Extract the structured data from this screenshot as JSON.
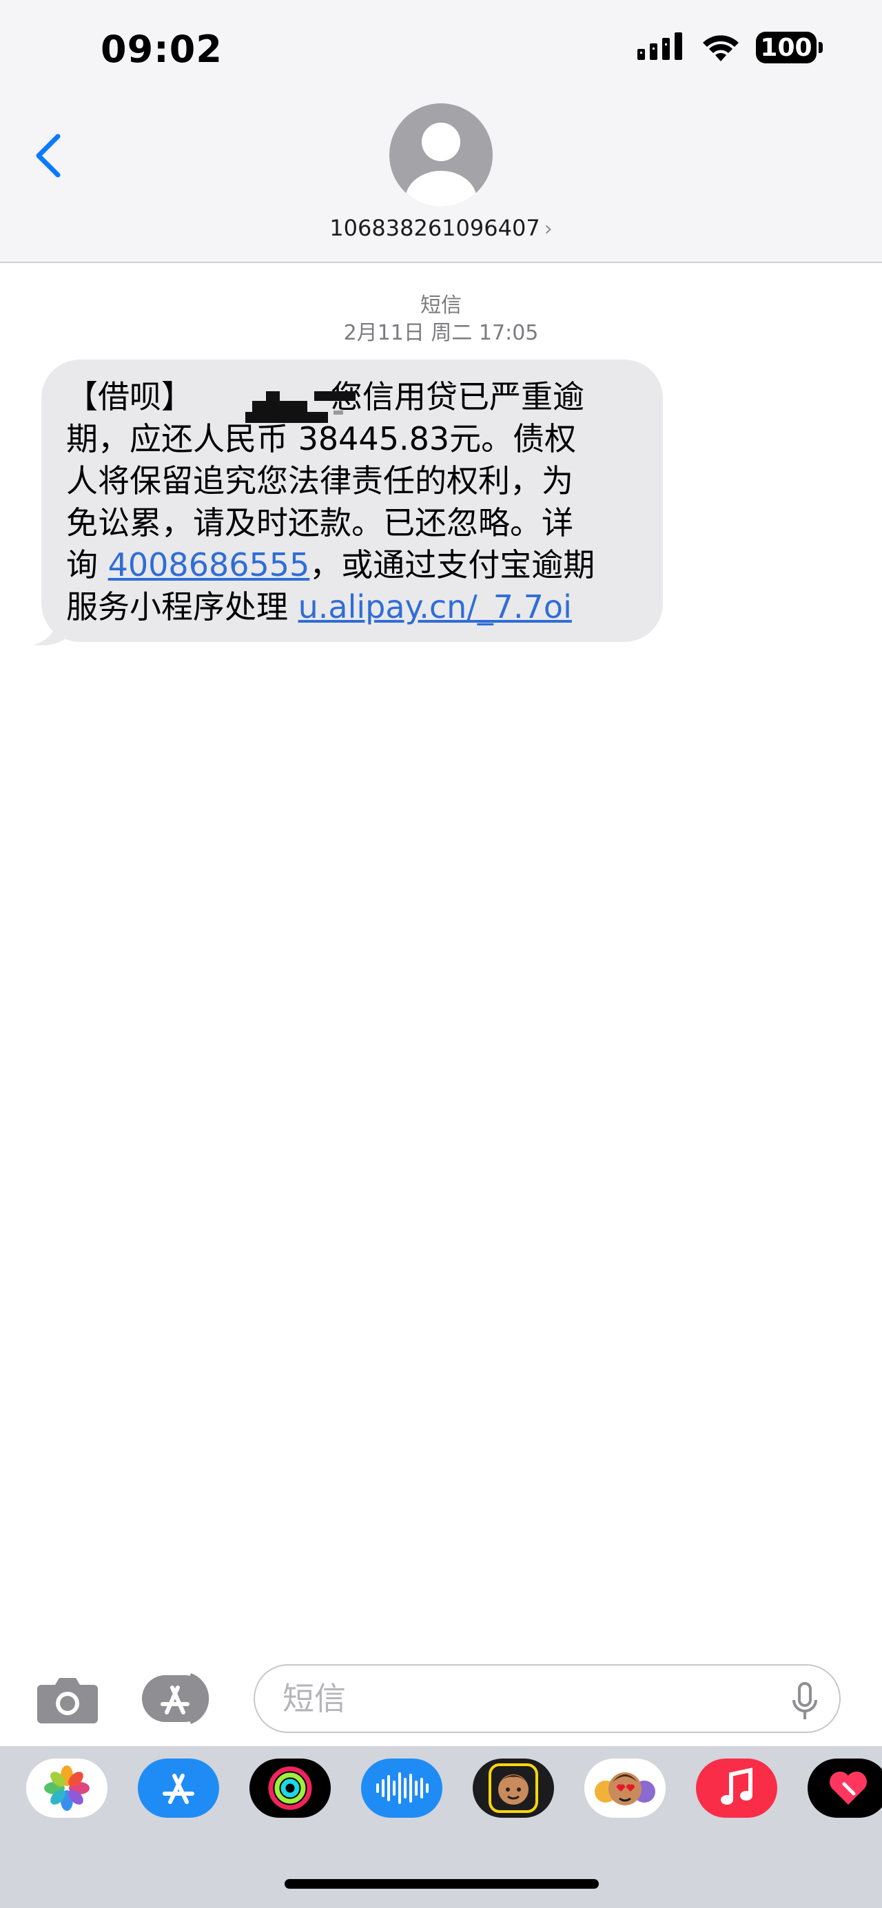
{
  "status_bar": {
    "time": "09:02",
    "battery": "100"
  },
  "header": {
    "sender": "106838261096407",
    "chevron": "›"
  },
  "conversation": {
    "service_label": "短信",
    "date_label": "2月11日 周二 17:05",
    "message": {
      "line1_prefix": "【借呗】",
      "line1_rest": "您信用贷已严重逾",
      "line2": "期，应还人民币 38445.83元。债权",
      "line3": "人将保留追究您法律责任的权利，为",
      "line4": "免讼累，请及时还款。已还忽略。详",
      "line5_prefix": "询 ",
      "phone_link": "4008686555",
      "line5_rest": "，或通过支付宝逾期",
      "line6_prefix": "服务小程序处理 ",
      "url_link": "u.alipay.cn/_7.7oi"
    }
  },
  "input_bar": {
    "placeholder": "短信"
  },
  "app_drawer": {
    "apps": [
      {
        "icon": "photos-icon"
      },
      {
        "icon": "app-store-icon"
      },
      {
        "icon": "activity-icon"
      },
      {
        "icon": "audio-message-icon"
      },
      {
        "icon": "memoji-icon"
      },
      {
        "icon": "memoji-stickers-icon"
      },
      {
        "icon": "music-icon"
      },
      {
        "icon": "digital-touch-icon"
      }
    ]
  },
  "colors": {
    "link": "#2f6dd6",
    "accent": "#0a7aff",
    "bubble": "#e9e9eb"
  }
}
